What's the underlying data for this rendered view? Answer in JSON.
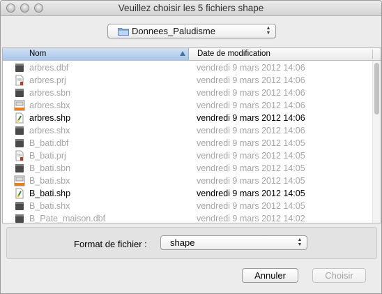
{
  "window": {
    "title": "Veuillez choisir les 5 fichiers shape"
  },
  "folder_popup": {
    "value": "Donnees_Paludisme",
    "icon": "folder-icon"
  },
  "list": {
    "columns": {
      "name": "Nom",
      "date": "Date de modification"
    },
    "files": [
      {
        "name": "arbres.dbf",
        "date": "vendredi 9 mars 2012 14:06",
        "enabled": false,
        "icon": "generic-file-icon"
      },
      {
        "name": "arbres.prj",
        "date": "vendredi 9 mars 2012 14:06",
        "enabled": false,
        "icon": "text-file-icon"
      },
      {
        "name": "arbres.sbn",
        "date": "vendredi 9 mars 2012 14:06",
        "enabled": false,
        "icon": "generic-file-icon"
      },
      {
        "name": "arbres.sbx",
        "date": "vendredi 9 mars 2012 14:06",
        "enabled": false,
        "icon": "app-file-icon"
      },
      {
        "name": "arbres.shp",
        "date": "vendredi 9 mars 2012 14:06",
        "enabled": true,
        "icon": "shape-file-icon"
      },
      {
        "name": "arbres.shx",
        "date": "vendredi 9 mars 2012 14:06",
        "enabled": false,
        "icon": "generic-file-icon"
      },
      {
        "name": "B_bati.dbf",
        "date": "vendredi 9 mars 2012 14:05",
        "enabled": false,
        "icon": "generic-file-icon"
      },
      {
        "name": "B_bati.prj",
        "date": "vendredi 9 mars 2012 14:05",
        "enabled": false,
        "icon": "text-file-icon"
      },
      {
        "name": "B_bati.sbn",
        "date": "vendredi 9 mars 2012 14:05",
        "enabled": false,
        "icon": "generic-file-icon"
      },
      {
        "name": "B_bati.sbx",
        "date": "vendredi 9 mars 2012 14:05",
        "enabled": false,
        "icon": "app-file-icon"
      },
      {
        "name": "B_bati.shp",
        "date": "vendredi 9 mars 2012 14:05",
        "enabled": true,
        "icon": "shape-file-icon"
      },
      {
        "name": "B_bati.shx",
        "date": "vendredi 9 mars 2012 14:05",
        "enabled": false,
        "icon": "generic-file-icon"
      },
      {
        "name": "B_Pate_maison.dbf",
        "date": "vendredi 9 mars 2012 14:02",
        "enabled": false,
        "icon": "generic-file-icon"
      }
    ]
  },
  "format": {
    "label": "Format de fichier :",
    "value": "shape"
  },
  "buttons": {
    "cancel": "Annuler",
    "choose": "Choisir"
  },
  "colors": {
    "selected_header": "#a8c6ea",
    "disabled_text": "#a5a5a5"
  }
}
